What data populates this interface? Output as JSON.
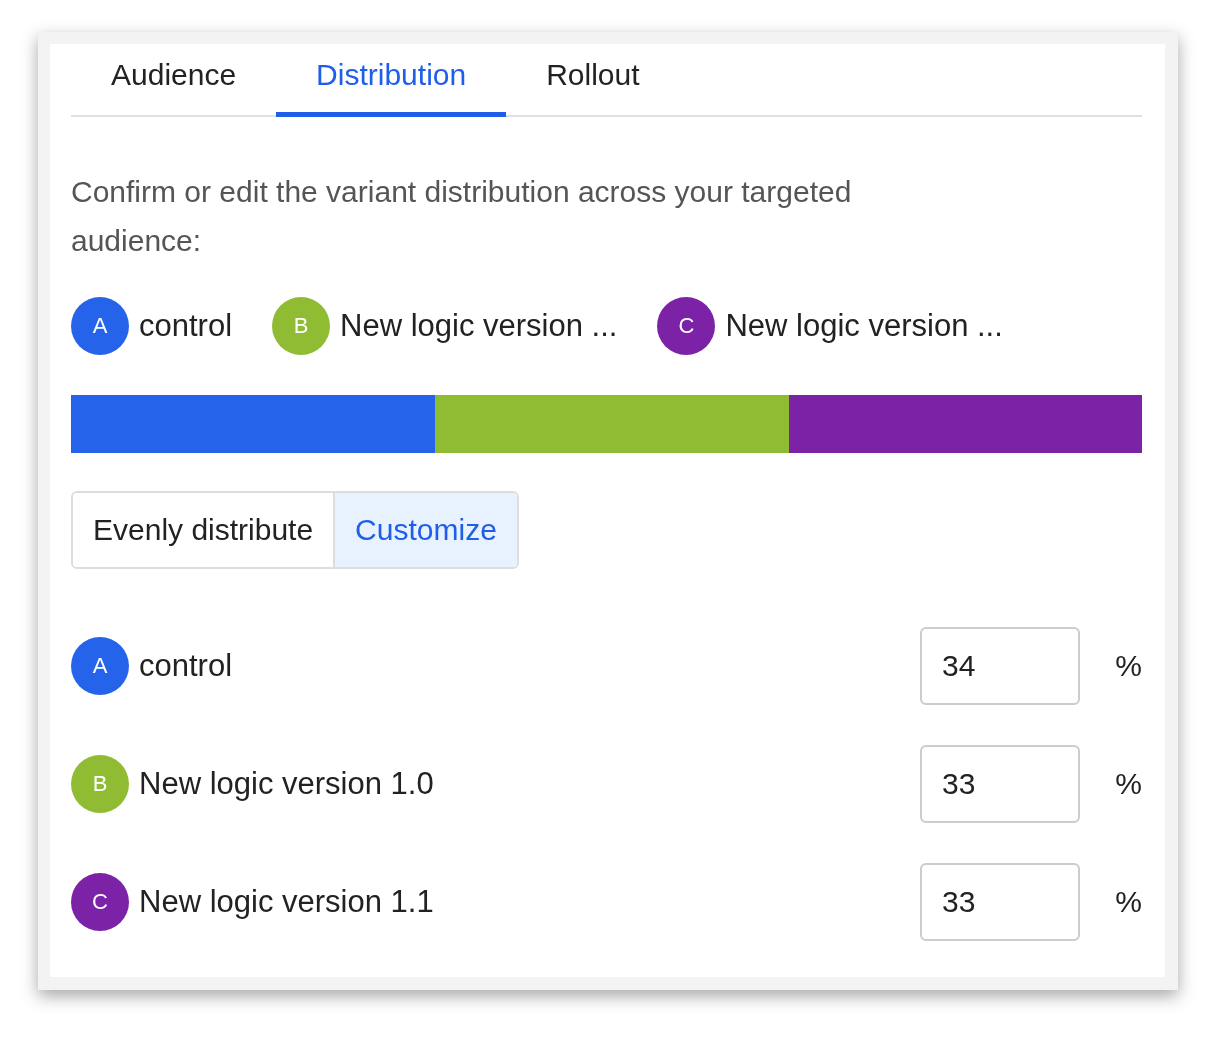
{
  "tabs": [
    {
      "label": "Audience",
      "selected": false
    },
    {
      "label": "Distribution",
      "selected": true
    },
    {
      "label": "Rollout",
      "selected": false
    }
  ],
  "description": "Confirm or edit the variant distribution across your targeted audience:",
  "legend": [
    {
      "letter": "A",
      "label": "control",
      "color": "#2563eb"
    },
    {
      "letter": "B",
      "label": "New logic version ...",
      "color": "#8fbc33"
    },
    {
      "letter": "C",
      "label": "New logic version ...",
      "color": "#7b22a6"
    }
  ],
  "mode_toggle": [
    {
      "label": "Evenly distribute",
      "selected": false
    },
    {
      "label": "Customize",
      "selected": true
    }
  ],
  "variants": [
    {
      "letter": "A",
      "name": "control",
      "color": "#2563eb",
      "value": "34",
      "unit": "%"
    },
    {
      "letter": "B",
      "name": "New logic version 1.0",
      "color": "#8fbc33",
      "value": "33",
      "unit": "%"
    },
    {
      "letter": "C",
      "name": "New logic version 1.1",
      "color": "#7b22a6",
      "value": "33",
      "unit": "%"
    }
  ]
}
